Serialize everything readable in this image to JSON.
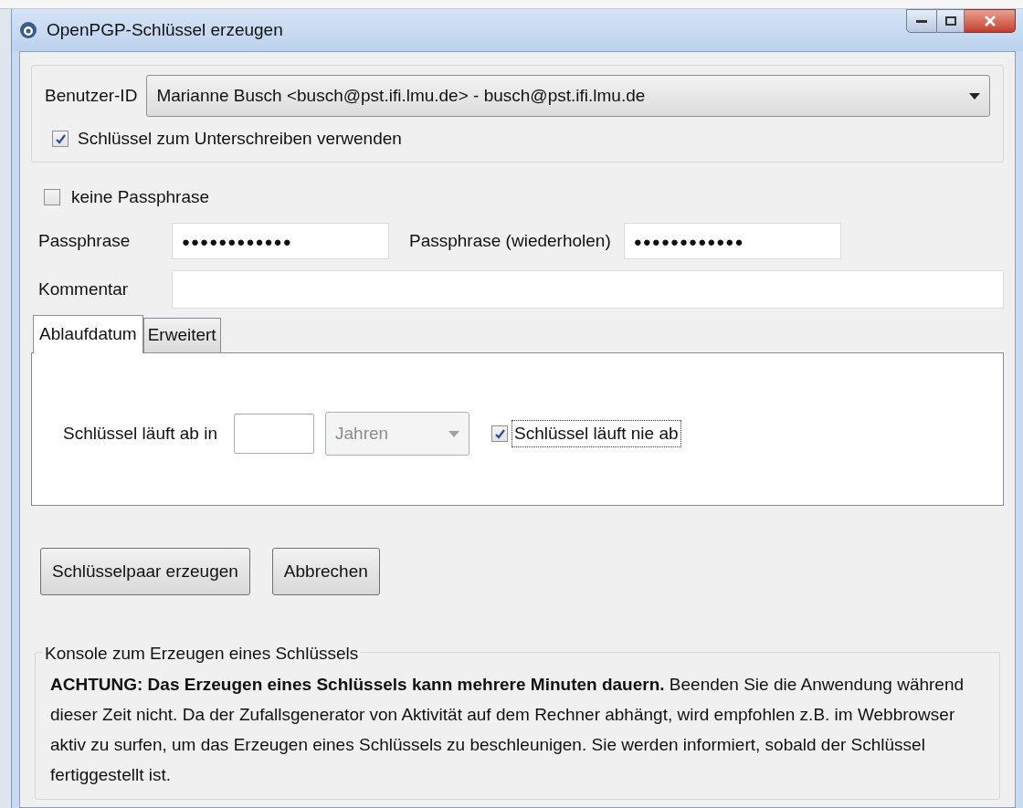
{
  "window": {
    "title": "OpenPGP-Schlüssel erzeugen"
  },
  "user_id": {
    "label": "Benutzer-ID",
    "value": "Marianne Busch <busch@pst.ifi.lmu.de> - busch@pst.ifi.lmu.de"
  },
  "sign_checkbox": {
    "label": "Schlüssel zum Unterschreiben verwenden",
    "checked": true
  },
  "no_passphrase": {
    "label": "keine Passphrase",
    "checked": false
  },
  "passphrase": {
    "label": "Passphrase",
    "value": "●●●●●●●●●●●●"
  },
  "passphrase_repeat": {
    "label": "Passphrase (wiederholen)",
    "value": "●●●●●●●●●●●●"
  },
  "comment": {
    "label": "Kommentar"
  },
  "tabs": [
    {
      "label": "Ablaufdatum",
      "selected": true
    },
    {
      "label": "Erweitert",
      "selected": false
    }
  ],
  "expiry": {
    "label": "Schlüssel läuft ab in",
    "unit": "Jahren",
    "unit_disabled": true,
    "never": {
      "label": "Schlüssel läuft nie ab",
      "checked": true
    }
  },
  "buttons": [
    "Schlüsselpaar erzeugen",
    "Abbrechen"
  ],
  "console": {
    "title": "Konsole zum Erzeugen eines Schlüssels",
    "text": "**ACHTUNG: Das Erzeugen eines Schlüssels kann mehrere Minuten dauern.** Beenden Sie die Anwendung während dieser Zeit nicht. Da der Zufallsgenerator von Aktivität auf dem Rechner abhängt, wird empfohlen z.B. im Webbrowser aktiv zu surfen, um das Erzeugen eines Schlüssels zu beschleunigen. Sie werden informiert, sobald der Schlüssel fertiggestellt ist."
  }
}
